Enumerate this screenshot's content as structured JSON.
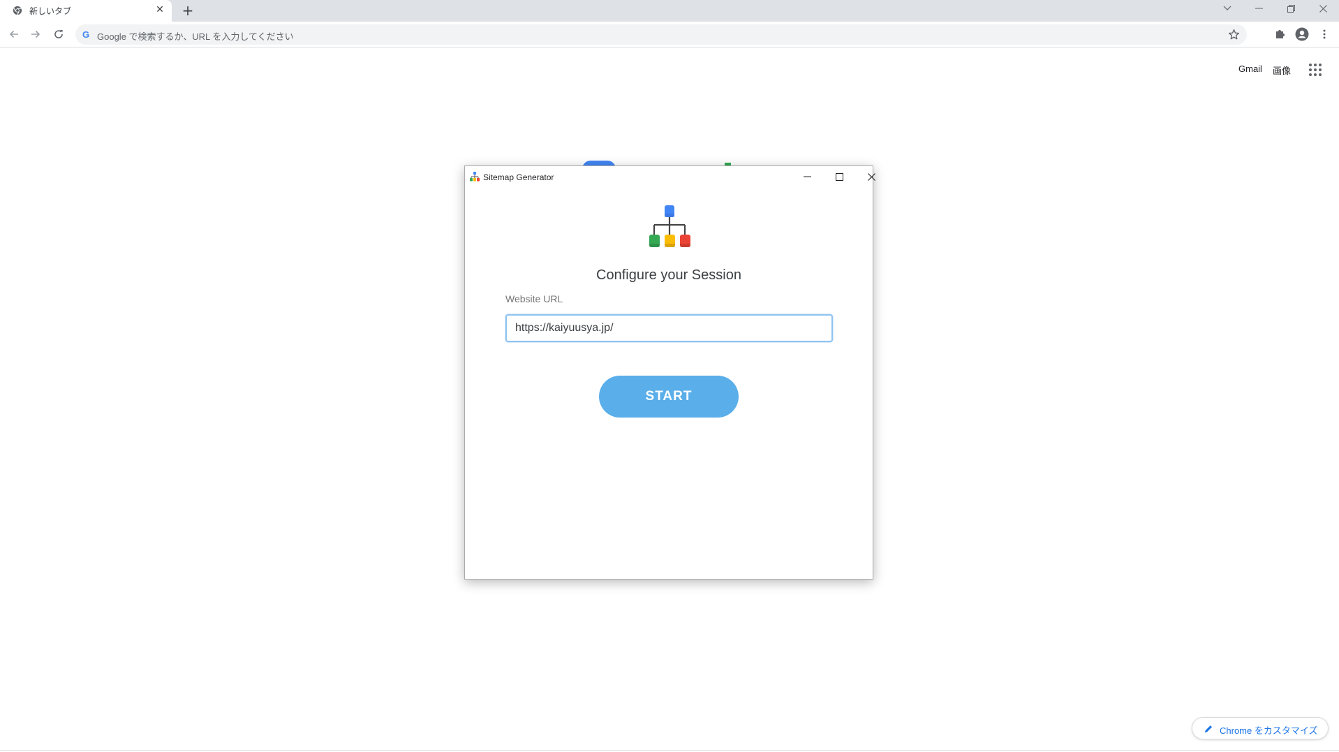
{
  "browser": {
    "tab": {
      "title": "新しいタブ",
      "favicon": "chrome-icon",
      "close_icon": "close-icon"
    },
    "new_tab_icon": "plus-icon",
    "window_controls": [
      "chevron-down-icon",
      "minimize-icon",
      "restore-icon",
      "close-icon"
    ],
    "toolbar": {
      "back_icon": "back-arrow-icon",
      "forward_icon": "forward-arrow-icon",
      "reload_icon": "reload-icon",
      "omnibox_placeholder": "Google で検索するか、URL を入力してください",
      "omnibox_g": "G",
      "bookmark_icon": "star-icon",
      "extensions_icon": "puzzle-icon",
      "profile_icon": "profile-icon",
      "menu_icon": "kebab-menu-icon"
    }
  },
  "ntp": {
    "links": {
      "gmail": "Gmail",
      "images": "画像"
    },
    "apps_icon": "apps-grid-icon",
    "customize_label": "Chrome をカスタマイズ",
    "customize_icon": "pencil-icon"
  },
  "app_window": {
    "title": "Sitemap Generator",
    "title_icon": "sitemap-icon",
    "controls": [
      "minimize-icon",
      "maximize-icon",
      "close-icon"
    ],
    "logo": "sitemap-logo-icon",
    "heading": "Configure your Session",
    "url_field": {
      "label": "Website URL",
      "value": "https://kaiyuusya.jp/"
    },
    "start_button": "START"
  },
  "colors": {
    "tabstrip": "#dee1e6",
    "start_button": "#5aaeea",
    "input_focus_border": "#8fc3f0",
    "logo_blue": "#4285f4",
    "logo_green": "#34a853",
    "logo_yellow": "#fbbc05",
    "logo_red": "#ea4335",
    "link_blue": "#1a73e8"
  }
}
